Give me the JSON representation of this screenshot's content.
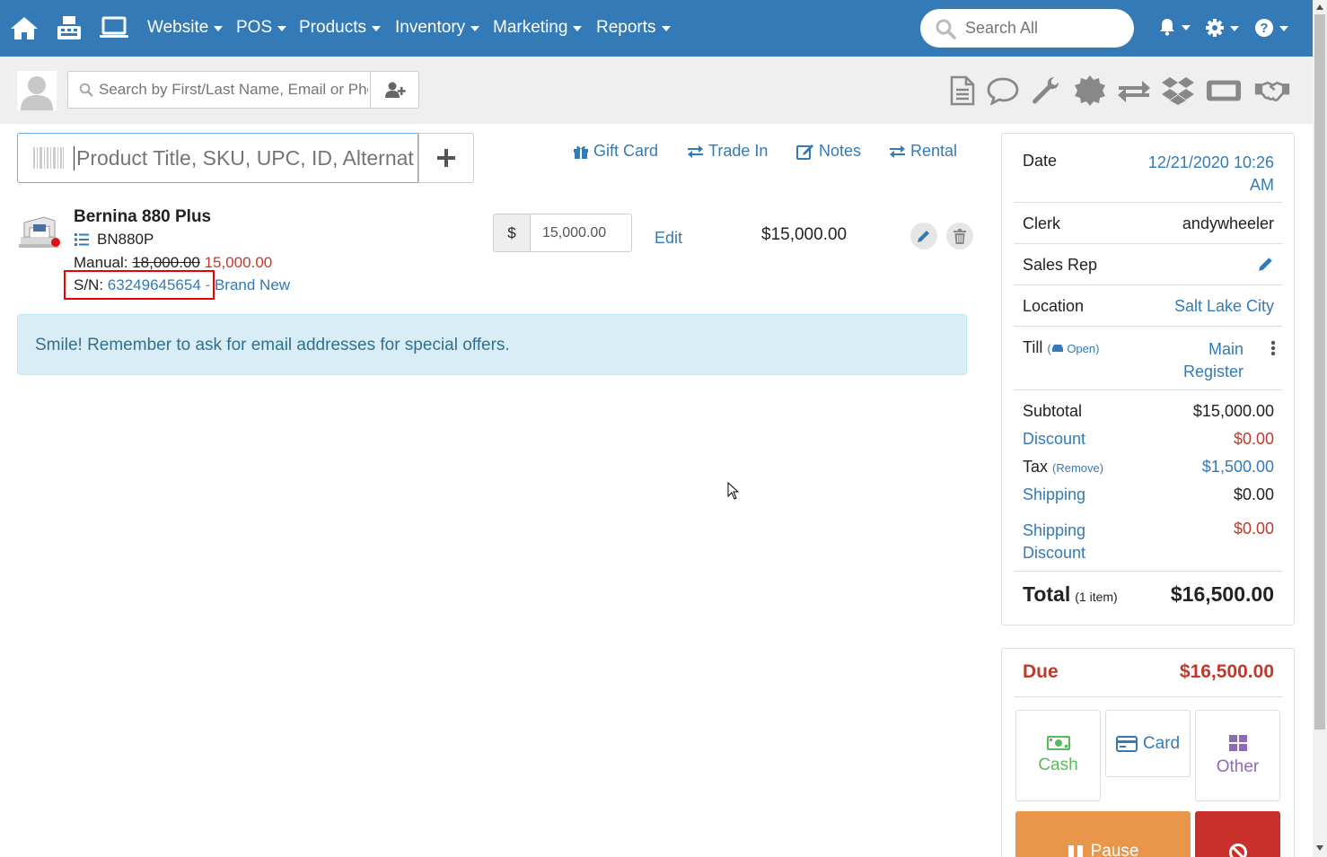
{
  "nav": {
    "menus": [
      "Website",
      "POS",
      "Products",
      "Inventory",
      "Marketing",
      "Reports"
    ],
    "search_placeholder": "Search All"
  },
  "customer": {
    "search_placeholder": "Search by First/Last Name, Email or Phone"
  },
  "product_search": {
    "placeholder": "Product Title, SKU, UPC, ID, Alternative"
  },
  "actions": {
    "gift_card": "Gift Card",
    "trade_in": "Trade In",
    "notes": "Notes",
    "rental": "Rental"
  },
  "line_item": {
    "title": "Bernina 880 Plus",
    "sku": "BN880P",
    "manual_label": "Manual:",
    "old_price": "18,000.00",
    "new_price": "15,000.00",
    "sn_label": "S/N:",
    "sn_value": "63249645654",
    "condition_sep": "-",
    "condition": "Brand New",
    "currency": "$",
    "price_value": "15,000.00",
    "edit_label": "Edit",
    "line_total": "$15,000.00"
  },
  "alert": {
    "text": "Smile! Remember to ask for email addresses for special offers."
  },
  "summary": {
    "date_label": "Date",
    "date_value_1": "12/21/2020 10:26",
    "date_value_2": "AM",
    "clerk_label": "Clerk",
    "clerk_value": "andywheeler",
    "sales_rep_label": "Sales Rep",
    "location_label": "Location",
    "location_value": "Salt Lake City",
    "till_label": "Till",
    "till_status": "Open",
    "till_value_1": "Main",
    "till_value_2": "Register",
    "subtotal_label": "Subtotal",
    "subtotal_value": "$15,000.00",
    "discount_label": "Discount",
    "discount_value": "$0.00",
    "tax_label": "Tax",
    "tax_remove": "(Remove)",
    "tax_value": "$1,500.00",
    "shipping_label": "Shipping",
    "shipping_value": "$0.00",
    "shipping_discount_label_1": "Shipping",
    "shipping_discount_label_2": "Discount",
    "shipping_discount_value": "$0.00",
    "total_label": "Total",
    "total_items": "(1 item)",
    "total_value": "$16,500.00"
  },
  "due": {
    "label": "Due",
    "value": "$16,500.00",
    "cash": "Cash",
    "card": "Card",
    "other": "Other",
    "pause": "Pause"
  },
  "colors": {
    "brand": "#337ab7",
    "danger": "#c0392b",
    "cash": "#5cb85c",
    "other": "#8e6bb5",
    "pause": "#e8964a",
    "cancel": "#c9302c"
  }
}
